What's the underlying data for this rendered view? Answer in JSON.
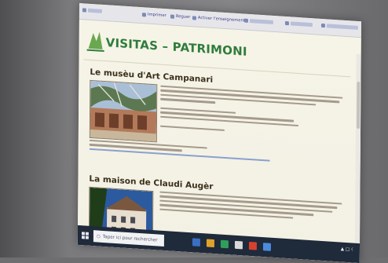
{
  "site": {
    "title": "VISITAS – PATRIMONI"
  },
  "browser": {
    "bookmarks": [
      {
        "label": "Imprimer"
      },
      {
        "label": "Reguer"
      },
      {
        "label": "Activer l'enseignement"
      }
    ]
  },
  "sections": [
    {
      "title": "Le musèu d'Art Campanari"
    },
    {
      "title": "La maison de Claudi Augèr"
    }
  ],
  "taskbar": {
    "search_placeholder": "Taper ici pour rechercher"
  },
  "colors": {
    "title_green": "#2f7c3c",
    "heading_brown": "#3b2f1c",
    "page_bg": "#f6f4e7",
    "link_blue": "#8aa0cf"
  }
}
